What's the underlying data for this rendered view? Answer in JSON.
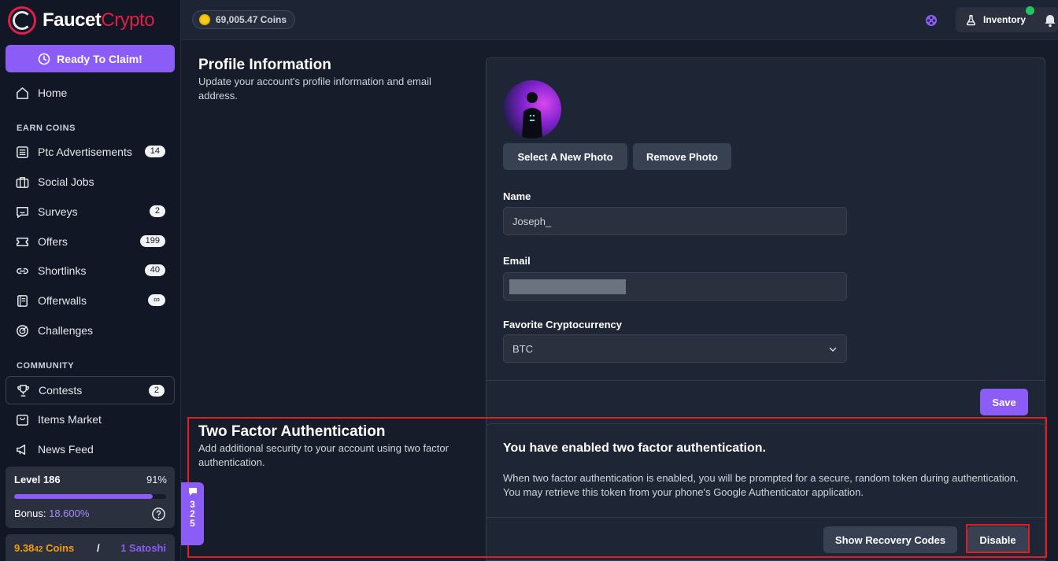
{
  "brand": {
    "part1": "Faucet",
    "part2": "Crypto"
  },
  "sidebar": {
    "claim_label": "Ready To Claim!",
    "home": "Home",
    "earn_heading": "EARN COINS",
    "earn_items": [
      {
        "label": "Ptc Advertisements",
        "badge": "14"
      },
      {
        "label": "Social Jobs",
        "badge": ""
      },
      {
        "label": "Surveys",
        "badge": "2"
      },
      {
        "label": "Offers",
        "badge": "199"
      },
      {
        "label": "Shortlinks",
        "badge": "40"
      },
      {
        "label": "Offerwalls",
        "badge": "∞"
      },
      {
        "label": "Challenges",
        "badge": ""
      }
    ],
    "community_heading": "COMMUNITY",
    "community_items": [
      {
        "label": "Contests",
        "badge": "2"
      },
      {
        "label": "Items Market",
        "badge": ""
      },
      {
        "label": "News Feed",
        "badge": ""
      }
    ],
    "level": {
      "title": "Level 186",
      "percent": "91%",
      "progress": 0.91,
      "bonus_label": "Bonus:",
      "bonus_value": "18.600%"
    },
    "balance": {
      "coins_main": "9.38",
      "coins_small": "42",
      "coins_unit": "Coins",
      "separator": "/",
      "satoshi": "1 Satoshi"
    }
  },
  "topbar": {
    "coins": "69,005.47 Coins",
    "inventory_label": "Inventory"
  },
  "profile": {
    "title": "Profile Information",
    "description": "Update your account's profile information and email address.",
    "select_photo": "Select A New Photo",
    "remove_photo": "Remove Photo",
    "name_label": "Name",
    "name_value": "Joseph_",
    "email_label": "Email",
    "crypto_label": "Favorite Cryptocurrency",
    "crypto_value": "BTC",
    "save_label": "Save"
  },
  "tfa": {
    "title": "Two Factor Authentication",
    "description": "Add additional security to your account using two factor authentication.",
    "heading": "You have enabled two factor authentication.",
    "body": "When two factor authentication is enabled, you will be prompted for a secure, random token during authentication. You may retrieve this token from your phone's Google Authenticator application.",
    "recovery_label": "Show Recovery Codes",
    "disable_label": "Disable"
  },
  "chat": {
    "count": "325"
  },
  "colors": {
    "accent": "#8b5cf6",
    "brand_red": "#e11d48",
    "highlight": "#e11d24",
    "coin": "#f59e0b"
  }
}
